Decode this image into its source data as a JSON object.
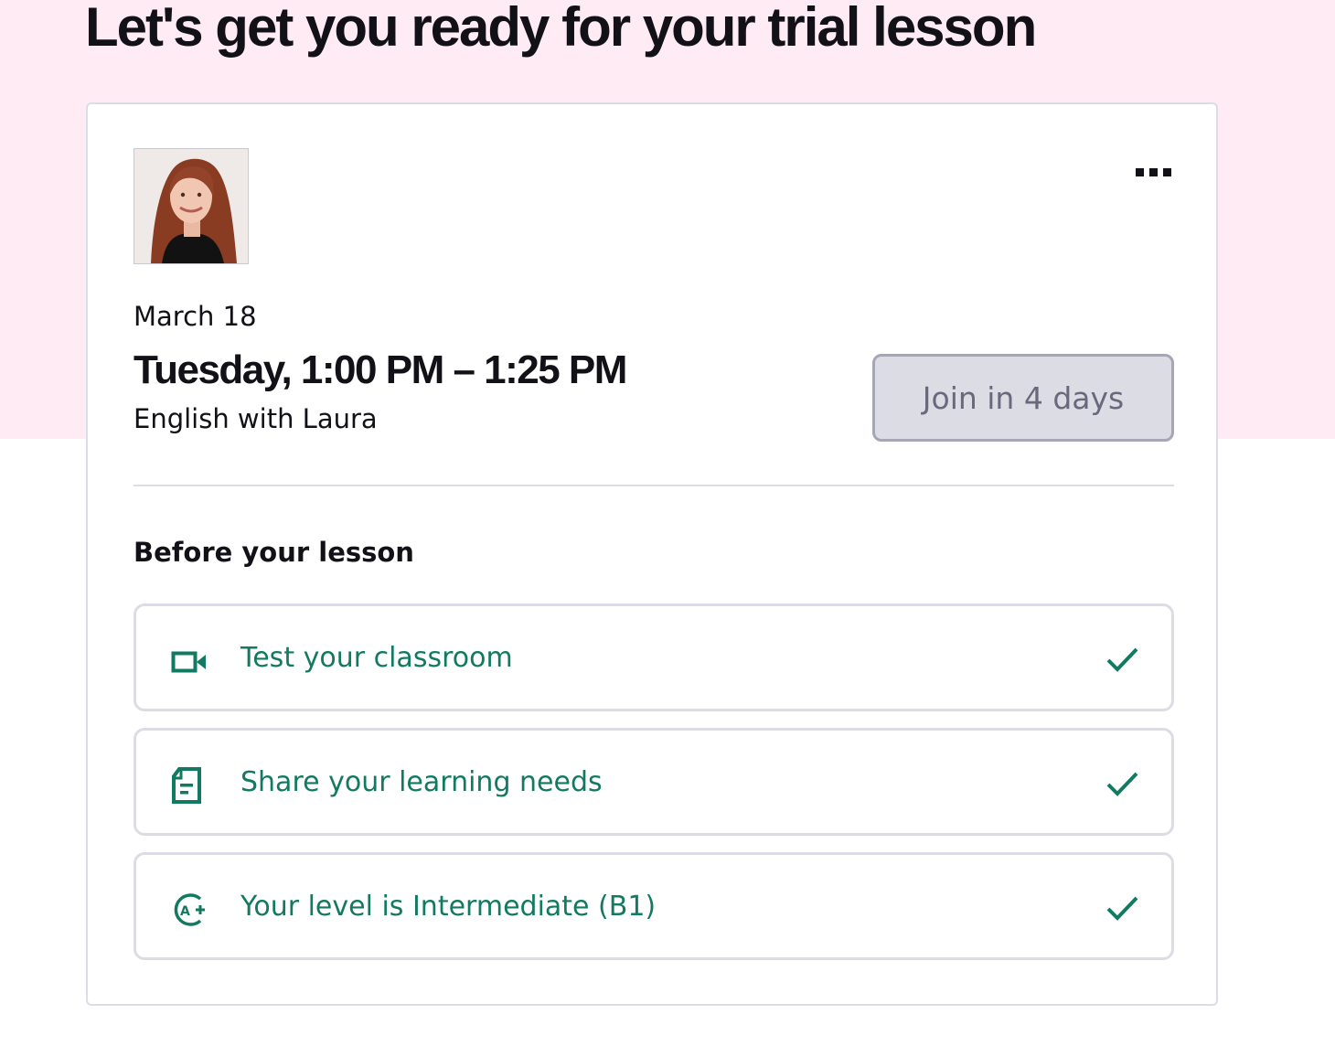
{
  "page": {
    "title": "Let's get you ready for your trial lesson"
  },
  "lesson": {
    "date": "March 18",
    "time": "Tuesday, 1:00 PM – 1:25 PM",
    "subject": "English with Laura",
    "join_label": "Join in 4 days",
    "tutor_photo_alt": "Laura"
  },
  "checklist": {
    "heading": "Before your lesson",
    "items": [
      {
        "label": "Test your classroom",
        "icon": "video-camera-icon",
        "done": true
      },
      {
        "label": "Share your learning needs",
        "icon": "document-icon",
        "done": true
      },
      {
        "label": "Your level is Intermediate (B1)",
        "icon": "level-a-plus-icon",
        "done": true
      }
    ]
  },
  "colors": {
    "hero_background": "#ffebf4",
    "accent_green": "#137a62",
    "join_button_bg": "#dcdce5",
    "join_button_text": "#6a697c",
    "border": "#dcdce5"
  }
}
